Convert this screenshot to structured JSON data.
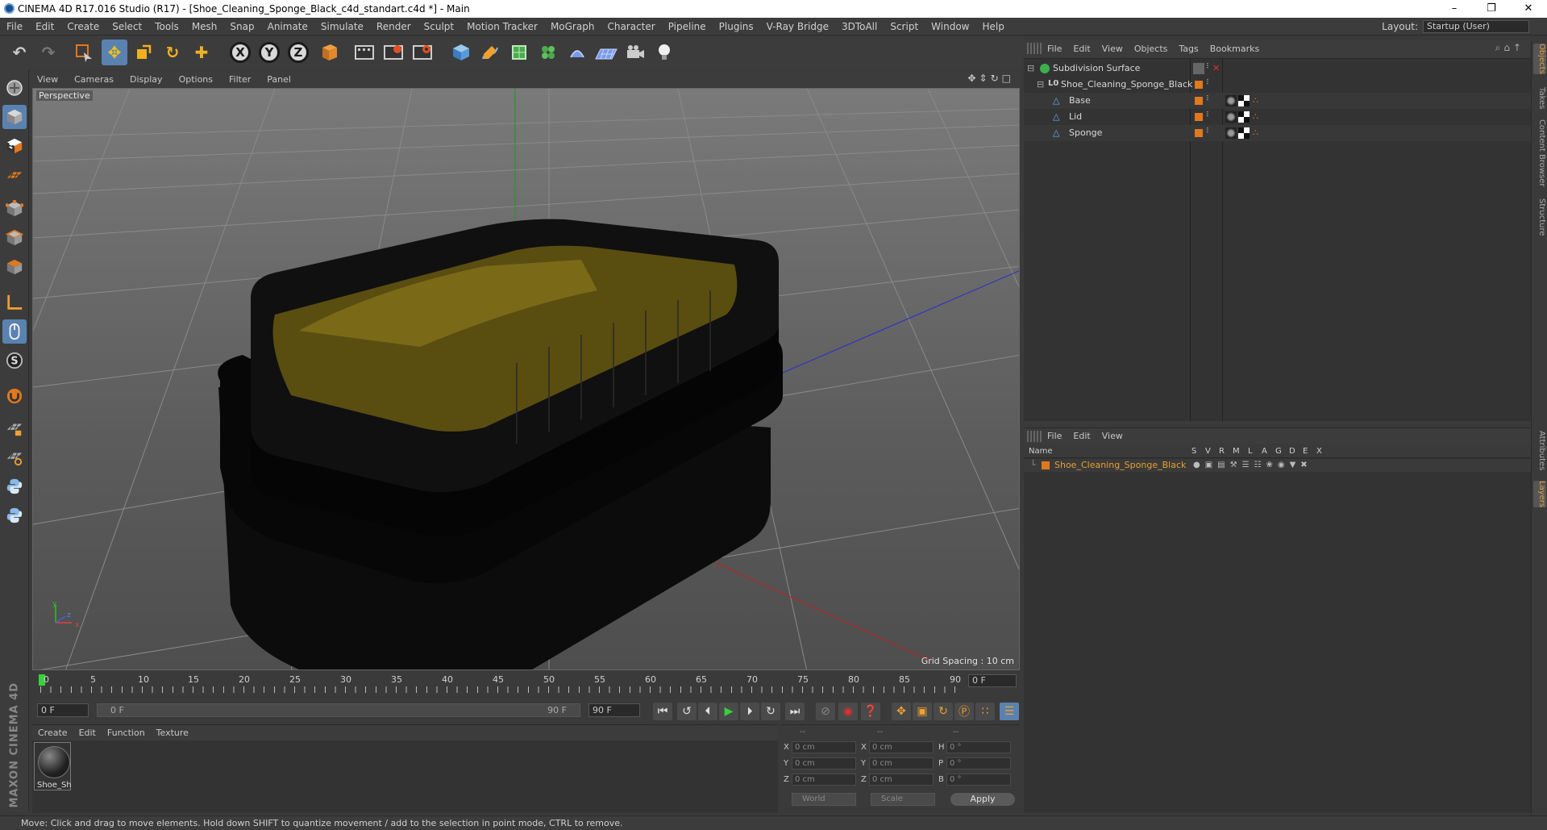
{
  "window": {
    "title": "CINEMA 4D R17.016 Studio (R17) - [Shoe_Cleaning_Sponge_Black_c4d_standart.c4d *] - Main",
    "minimize": "–",
    "maximize": "❐",
    "close": "✕"
  },
  "menubar": {
    "items": [
      "File",
      "Edit",
      "Create",
      "Select",
      "Tools",
      "Mesh",
      "Snap",
      "Animate",
      "Simulate",
      "Render",
      "Sculpt",
      "Motion Tracker",
      "MoGraph",
      "Character",
      "Pipeline",
      "Plugins",
      "V-Ray Bridge",
      "3DToAll",
      "Script",
      "Window",
      "Help"
    ],
    "layout_label": "Layout:",
    "layout_value": "Startup (User)"
  },
  "toolbar": {
    "axis_x": "X",
    "axis_y": "Y",
    "axis_z": "Z"
  },
  "viewport": {
    "menu": [
      "View",
      "Cameras",
      "Display",
      "Options",
      "Filter",
      "Panel"
    ],
    "label": "Perspective",
    "grid_spacing": "Grid Spacing : 10 cm",
    "axis_y": "y",
    "axis_z": "z",
    "axis_x": "x"
  },
  "timeline": {
    "ticks": [
      "0",
      "5",
      "10",
      "15",
      "20",
      "25",
      "30",
      "35",
      "40",
      "45",
      "50",
      "55",
      "60",
      "65",
      "70",
      "75",
      "80",
      "85",
      "90"
    ],
    "current_frame": "0 F",
    "start_frame": "0 F",
    "range_start": "0 F",
    "range_end": "90 F",
    "end_frame": "90 F"
  },
  "material": {
    "menu": [
      "Create",
      "Edit",
      "Function",
      "Texture"
    ],
    "name": "Shoe_Sh"
  },
  "coordinates": {
    "header": [
      "--",
      "--",
      "--"
    ],
    "rows": [
      {
        "l1": "X",
        "v1": "0 cm",
        "l2": "X",
        "v2": "0 cm",
        "l3": "H",
        "v3": "0 °"
      },
      {
        "l1": "Y",
        "v1": "0 cm",
        "l2": "Y",
        "v2": "0 cm",
        "l3": "P",
        "v3": "0 °"
      },
      {
        "l1": "Z",
        "v1": "0 cm",
        "l2": "Z",
        "v2": "0 cm",
        "l3": "B",
        "v3": "0 °"
      }
    ],
    "world": "World",
    "scale": "Scale",
    "apply": "Apply"
  },
  "objects": {
    "menu": [
      "File",
      "Edit",
      "View",
      "Objects",
      "Tags",
      "Bookmarks"
    ],
    "items": [
      {
        "name": "Subdivision Surface"
      },
      {
        "name": "Shoe_Cleaning_Sponge_Black"
      },
      {
        "name": "Base"
      },
      {
        "name": "Lid"
      },
      {
        "name": "Sponge"
      }
    ]
  },
  "layers": {
    "menu": [
      "File",
      "Edit",
      "View"
    ],
    "columns": [
      "Name",
      "S",
      "V",
      "R",
      "M",
      "L",
      "A",
      "G",
      "D",
      "E",
      "X"
    ],
    "row_name": "Shoe_Cleaning_Sponge_Black"
  },
  "side_tabs": [
    "Objects",
    "Takes",
    "Content Browser",
    "Structure",
    "Attributes",
    "Layers"
  ],
  "branding": "MAXON CINEMA 4D",
  "status": "Move: Click and drag to move elements. Hold down SHIFT to quantize movement / add to the selection in point mode, CTRL to remove.",
  "colors": {
    "accent": "#5a82b0",
    "orange": "#e07820",
    "layer_text": "#e8a030"
  }
}
